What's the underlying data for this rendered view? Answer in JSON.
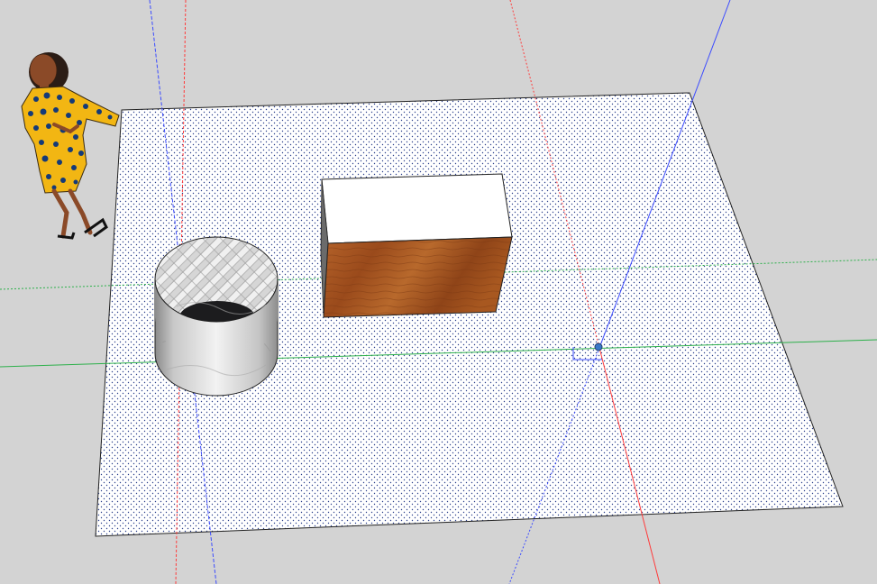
{
  "app": {
    "view": "3d-modeling-viewport",
    "background_color": "#d3d3d3"
  },
  "scene": {
    "objects": [
      {
        "name": "ground-plane",
        "color": "#ffffff",
        "pattern": "stipple-dots"
      },
      {
        "name": "box",
        "top_color": "#ffffff",
        "front_material": "wood",
        "front_color": "#a4531f"
      },
      {
        "name": "cylinder",
        "outer_material": "marble",
        "inner_material": "herringbone-tile",
        "interior_color": "#1c1c1e"
      },
      {
        "name": "person-figure",
        "dress_color": "#f2b613",
        "dots_color": "#143a78",
        "skin_color": "#8b4a28"
      }
    ],
    "axes": {
      "red": "#ff3b3b",
      "green": "#2db04b",
      "blue": "#3b4bff"
    }
  }
}
